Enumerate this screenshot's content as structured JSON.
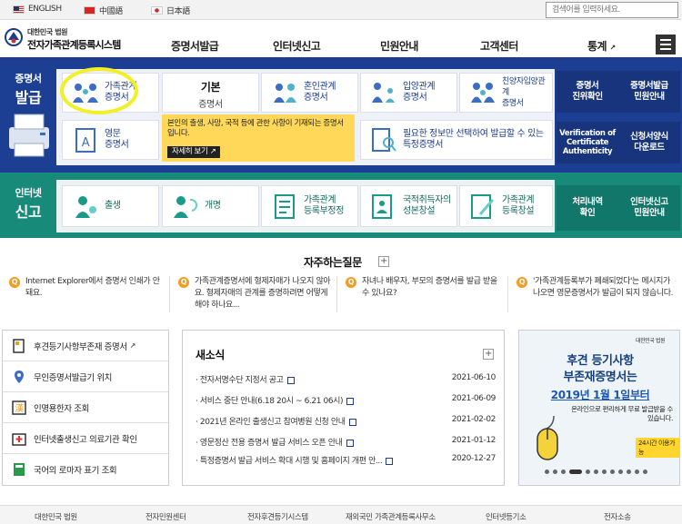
{
  "lang": {
    "en": "ENGLISH",
    "cn": "中國語",
    "jp": "日本語"
  },
  "search": {
    "placeholder": "검색어를 입력하세요."
  },
  "logo": {
    "sub": "대한민국 법원",
    "main": "전자가족관계등록시스템"
  },
  "nav": [
    "증명서발급",
    "인터넷신고",
    "민원안내",
    "고객센터",
    "통계"
  ],
  "ext_mark": "↗",
  "issue": {
    "label_small": "증명서",
    "label_big": "발급",
    "cards": {
      "family": "가족관계\n증명서",
      "basic_t1": "기본",
      "basic_t2": "증명서",
      "marriage": "혼인관계\n증명서",
      "adoption": "입양관계\n증명서",
      "special_adoption": "친양자입양관계\n증명서",
      "english": "영문\n증명서",
      "specific": "필요한 정보만 선택하여 발급할 수 있는\n특정증명서"
    },
    "notice": "본인의 출생, 사망, 국적 등에 관한 사항이 기재되는 증명서입니다.",
    "notice_btn": "자세히 보기",
    "side": [
      "증명서\n진위확인",
      "증명서발급\n민원안내",
      "Verification of\nCertificate\nAuthenticity",
      "신청서양식\n다운로드"
    ]
  },
  "report": {
    "label_small": "인터넷",
    "label_big": "신고",
    "cards": [
      "출생",
      "개명",
      "가족관계\n등록부정정",
      "국적취득자의\n성본창설",
      "가족관계\n등록창설"
    ],
    "side": [
      "처리내역\n확인",
      "인터넷신고\n민원안내"
    ]
  },
  "faq": {
    "title": "자주하는질문",
    "plus": "+",
    "q": "Q",
    "items": [
      "Internet Explorer에서 증명서 인쇄가 안돼요.",
      "가족관계증명서에 형제자매가 나오지 않아요. 형제자매의 관계를 증명하려면 어떻게 해야 하나요...",
      "자녀나 배우자, 부모의 증명서를 발급 받을 수 있나요?",
      "'가족관계등록부가 폐쇄되었다'는 메시지가 나오면 영문증명서가 발급이 되지 않습니다."
    ]
  },
  "quick_links": [
    "후견등기사항부존재 증명서",
    "무인증명서발급기 위치",
    "인명용한자 조회",
    "인터넷출생신고 의료기관 확인",
    "국어의 로마자 표기 조회"
  ],
  "news": {
    "title": "새소식",
    "plus": "+",
    "items": [
      {
        "title": "전자서명수단 지정서 공고",
        "date": "2021-06-10"
      },
      {
        "title": "서비스 중단 안내(6.18 20시 ~ 6.21 06시)",
        "date": "2021-06-09"
      },
      {
        "title": "2021년 온라인 출생신고 참여병원 신청 안내",
        "date": "2021-02-02"
      },
      {
        "title": "영문정산 전용 증명서 발급 서비스 오픈 안내",
        "date": "2021-01-12"
      },
      {
        "title": "특정증명서 발급 서비스 확대 시행 및 홈페이지 개편 안...",
        "date": "2020-12-27"
      }
    ]
  },
  "banner": {
    "org": "대한민국 법원",
    "t1": "후견 등기사항",
    "t2": "부존재증명서는",
    "t3": "2019년 1월 1일부터",
    "t4": "온라인으로 편리하게 무료 발급받을 수 있습니다.",
    "badge": "24시간 이용가능"
  },
  "footer": [
    "대한민국 법원",
    "전자민원센터",
    "전자후견등기시스템",
    "재외국민 가족관계등록사무소",
    "인터넷등기소",
    "전자소송"
  ]
}
